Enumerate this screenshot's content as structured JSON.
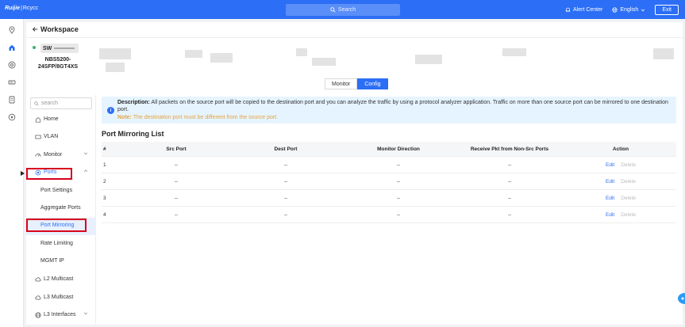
{
  "topbar": {
    "brand": "Ruijie",
    "sep": "|",
    "brand2": "Rcycc",
    "search_label": "Search",
    "alert_label": "Alert Center",
    "language_label": "English",
    "exit_label": "Exit"
  },
  "workspace": {
    "title": "Workspace"
  },
  "device": {
    "label": "SW",
    "model": "NBS5200-24SFP/8GT4XS"
  },
  "tabs": [
    {
      "label": "Monitor"
    },
    {
      "label": "Config"
    }
  ],
  "sidenav": {
    "search_placeholder": "search",
    "items": [
      {
        "label": "Home"
      },
      {
        "label": "VLAN"
      },
      {
        "label": "Monitor"
      },
      {
        "label": "Ports"
      },
      {
        "label": "Port Settings"
      },
      {
        "label": "Aggregate Ports"
      },
      {
        "label": "Port Mirroring"
      },
      {
        "label": "Rate Limiting"
      },
      {
        "label": "MGMT IP"
      },
      {
        "label": "L2 Multicast"
      },
      {
        "label": "L3 Multicast"
      },
      {
        "label": "L3 Interfaces"
      }
    ]
  },
  "description": {
    "prefix": "Description:",
    "text": "All packets on the source port will be copied to the destination port and you can analyze the traffic by using a protocol analyzer application. Traffic on more than one source port can be mirrored to one destination port.",
    "note_prefix": "Note:",
    "note_text": "The destination port must be different from the source port."
  },
  "list": {
    "title": "Port Mirroring List",
    "columns": [
      "#",
      "Src Port",
      "Dest Port",
      "Monitor Direction",
      "Receive Pkt from Non-Src Ports",
      "Action"
    ],
    "rows": [
      {
        "id": "1",
        "src": "--",
        "dest": "--",
        "direction": "--",
        "receive": "--",
        "edit": "Edit",
        "delete": "Delete"
      },
      {
        "id": "2",
        "src": "--",
        "dest": "--",
        "direction": "--",
        "receive": "--",
        "edit": "Edit",
        "delete": "Delete"
      },
      {
        "id": "3",
        "src": "--",
        "dest": "--",
        "direction": "--",
        "receive": "--",
        "edit": "Edit",
        "delete": "Delete"
      },
      {
        "id": "4",
        "src": "--",
        "dest": "--",
        "direction": "--",
        "receive": "--",
        "edit": "Edit",
        "delete": "Delete"
      }
    ]
  },
  "colors": {
    "accent": "#2c6ef5",
    "highlight": "#d9001b",
    "note": "#e6a23c"
  }
}
